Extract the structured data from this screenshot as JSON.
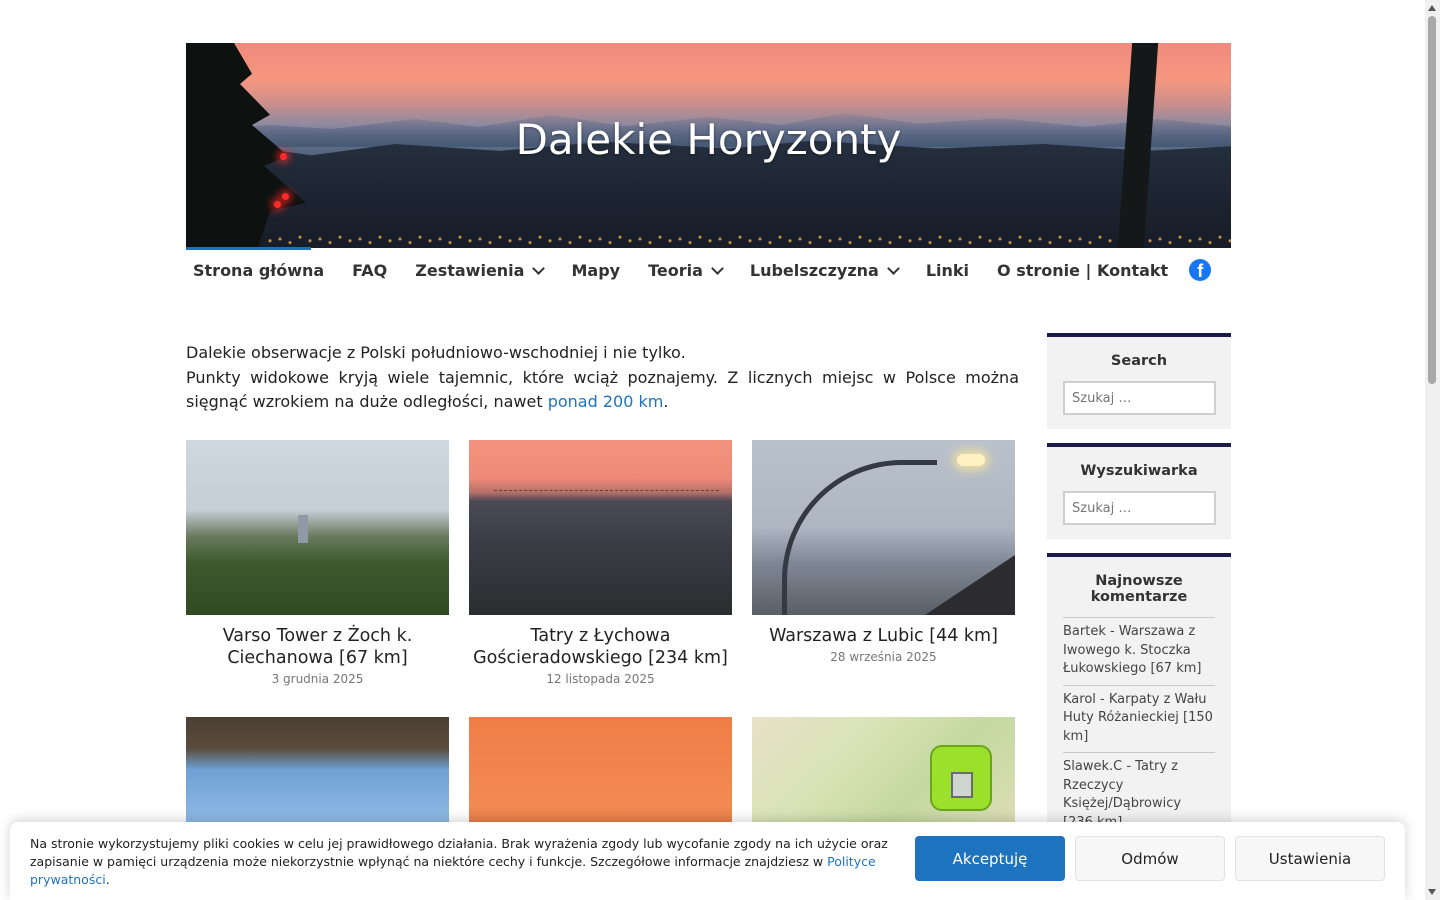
{
  "site": {
    "title": "Dalekie Horyzonty"
  },
  "nav": {
    "items": [
      {
        "label": "Strona główna",
        "has_dropdown": false,
        "active": true
      },
      {
        "label": "FAQ",
        "has_dropdown": false
      },
      {
        "label": "Zestawienia",
        "has_dropdown": true
      },
      {
        "label": "Mapy",
        "has_dropdown": false
      },
      {
        "label": "Teoria",
        "has_dropdown": true
      },
      {
        "label": "Lubelszczyzna",
        "has_dropdown": true
      },
      {
        "label": "Linki",
        "has_dropdown": false
      },
      {
        "label": "O stronie | Kontakt",
        "has_dropdown": false
      }
    ],
    "social_icon": "facebook-icon",
    "accent_color": "#1e73be"
  },
  "intro": {
    "line1": "Dalekie obserwacje z Polski południowo-wschodniej i nie tylko.",
    "line2_before": "Punkty widokowe kryją wiele tajemnic, które wciąż poznajemy. Z licznych miejsc w Polsce można sięgnąć wzrokiem na duże odległości, nawet ",
    "line2_link": "ponad 200 km",
    "line2_after": "."
  },
  "posts": [
    {
      "title": "Varso Tower z Żoch k. Ciechanowa [67 km]",
      "date": "3 grudnia 2025"
    },
    {
      "title": "Tatry z Łychowa Gościeradowskiego [234 km]",
      "date": "12 listopada 2025"
    },
    {
      "title": "Warszawa z Lubic [44 km]",
      "date": "28 września 2025"
    },
    {
      "title": "",
      "date": ""
    },
    {
      "title": "",
      "date": ""
    },
    {
      "title": "",
      "date": ""
    }
  ],
  "sidebar": {
    "search_widget": {
      "title": "Search",
      "placeholder": "Szukaj …"
    },
    "finder_widget": {
      "title": "Wyszukiwarka",
      "placeholder": "Szukaj …"
    },
    "comments_widget": {
      "title": "Najnowsze komentarze",
      "items": [
        "Bartek - Warszawa z Iwowego k. Stoczka Łukowskiego [67 km]",
        "Karol - Karpaty z Wału Huty Różanieckiej [150 km]",
        "Slawek.C - Tatry z Rzeczycy Księżej/Dąbrowicy [236 km]"
      ]
    }
  },
  "cookie": {
    "text_before": "Na stronie wykorzystujemy pliki cookies w celu jej prawidłowego działania. Brak wyrażenia zgody lub wycofanie zgody na ich użycie oraz zapisanie w pamięci urządzenia może niekorzystnie wpłynąć na niektóre cechy i funkcje. Szczegółowe informacje znajdziesz w ",
    "link": "Polityce prywatności",
    "text_after": ".",
    "accept": "Akceptuję",
    "deny": "Odmów",
    "settings": "Ustawienia"
  }
}
